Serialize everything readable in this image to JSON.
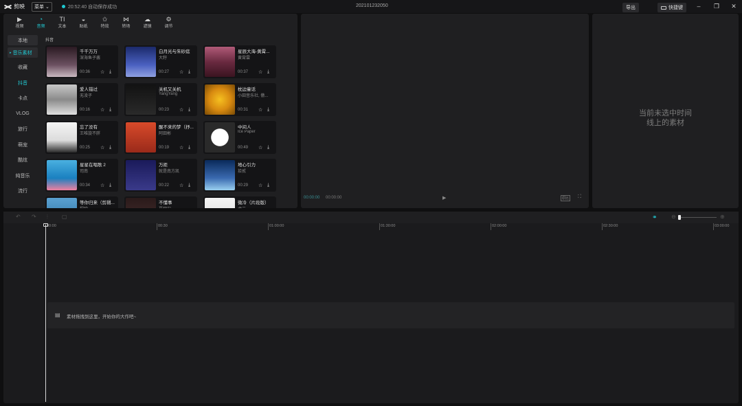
{
  "app": {
    "name": "剪映",
    "menu_label": "菜单",
    "save_status": "20:52:40 自动保存成功",
    "project_title": "202101232050",
    "export_label": "导出",
    "shortcut_label": "快捷键",
    "accent": "#22c9d3"
  },
  "toolbar": {
    "tabs": [
      {
        "label": "视频",
        "icon": "video-icon"
      },
      {
        "label": "音频",
        "icon": "audio-icon",
        "active": true
      },
      {
        "label": "文本",
        "icon": "text-icon"
      },
      {
        "label": "贴纸",
        "icon": "sticker-icon"
      },
      {
        "label": "特效",
        "icon": "effects-icon"
      },
      {
        "label": "转场",
        "icon": "transition-icon"
      },
      {
        "label": "滤镜",
        "icon": "filter-icon"
      },
      {
        "label": "调节",
        "icon": "adjust-icon"
      }
    ]
  },
  "sidebar": {
    "items": [
      {
        "label": "本地"
      },
      {
        "label": "音乐素材",
        "active": true
      },
      {
        "label": "收藏"
      },
      {
        "label": "抖音"
      },
      {
        "label": "卡点"
      },
      {
        "label": "VLOG"
      },
      {
        "label": "旅行"
      },
      {
        "label": "萌宠"
      },
      {
        "label": "酷炫"
      },
      {
        "label": "纯音乐"
      },
      {
        "label": "流行"
      }
    ]
  },
  "section_label": "抖音",
  "music": [
    {
      "title": "千千万万",
      "artist": "深海鱼子酱",
      "duration": "00:36"
    },
    {
      "title": "白月光与朱砂痣",
      "artist": "大籽",
      "duration": "00:27"
    },
    {
      "title": "星辰大海-黄霄...",
      "artist": "黄霄雲",
      "duration": "00:37"
    },
    {
      "title": "爱人错过",
      "artist": "无凌子",
      "duration": "00:16"
    },
    {
      "title": "关机又关机",
      "artist": "YangYang",
      "duration": "00:23"
    },
    {
      "title": "枕边童话",
      "artist": "小田音乐社, 傲...",
      "duration": "00:31"
    },
    {
      "title": "忘了没有",
      "artist": "王唯旋不胖",
      "duration": "00:25"
    },
    {
      "title": "醒不来的梦（抒...",
      "artist": "阿田彬",
      "duration": "00:19"
    },
    {
      "title": "中间人",
      "artist": "Ice Paper",
      "duration": "00:49"
    },
    {
      "title": "星星在唱歌 2",
      "artist": "司南",
      "duration": "00:34"
    },
    {
      "title": "万拒",
      "artist": "就是南方凯",
      "duration": "00:22"
    },
    {
      "title": "地心引力",
      "artist": "拾贰",
      "duration": "00:29"
    },
    {
      "title": "等你归来（剪辑...",
      "artist": "程响",
      "duration": ""
    },
    {
      "title": "不懂事",
      "artist": "夏婉安",
      "duration": ""
    },
    {
      "title": "微冷（片段版）",
      "artist": "虎二",
      "duration": ""
    }
  ],
  "preview": {
    "current_time": "00:00:00",
    "total_time": "00:00:00",
    "ratio_label": "原比"
  },
  "properties": {
    "empty_line1": "当前未选中时间",
    "empty_line2": "线上的素材"
  },
  "timeline": {
    "ticks": [
      "00:00",
      "00:30",
      "01:00:00",
      "01:30:00",
      "02:00:00",
      "02:30:00",
      "03:00:00"
    ],
    "drop_hint": "素材拖拽到这里，开始你的大作吧~"
  }
}
